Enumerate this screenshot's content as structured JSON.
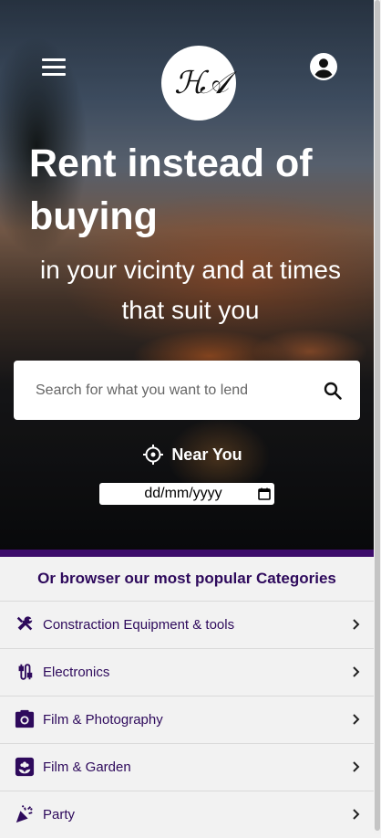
{
  "header": {
    "menu_icon": "hamburger-menu-icon",
    "logo_icon": "brand-monogram-logo",
    "logo_text": "ℋ𝒜",
    "account_icon": "account-circle-icon"
  },
  "hero": {
    "headline": "Rent instead of buying",
    "subline": "in your vicinty and at times that suit you"
  },
  "search": {
    "placeholder": "Search for what you want to lend",
    "value": "",
    "icon": "search-icon"
  },
  "near_you": {
    "label": "Near You",
    "icon": "crosshair-location-icon"
  },
  "date": {
    "placeholder": "dd/mm/yyyy",
    "icon": "calendar-icon"
  },
  "categories": {
    "title": "Or browser our most popular Categories",
    "items": [
      {
        "label": "Constraction Equipment & tools",
        "icon": "tools-icon"
      },
      {
        "label": "Electronics",
        "icon": "cable-icon"
      },
      {
        "label": "Film & Photography",
        "icon": "camera-icon"
      },
      {
        "label": "Film & Garden",
        "icon": "flower-icon"
      },
      {
        "label": "Party",
        "icon": "party-popper-icon"
      }
    ]
  },
  "colors": {
    "accent": "#3d0d6b",
    "text_dark": "#2e0a5c",
    "background": "#f2f2f2"
  }
}
